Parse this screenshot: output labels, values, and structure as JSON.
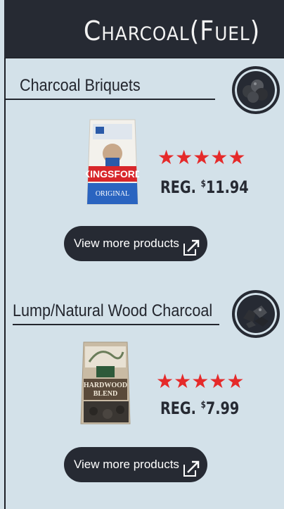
{
  "header": {
    "title": "Charcoal(Fuel)"
  },
  "sections": [
    {
      "title": "Charcoal Briquets",
      "icon": "charcoal-briquets-icon",
      "product_image": "kingsford-original-bag",
      "rating": "★★★★★",
      "price_prefix": "REG. ",
      "price_currency": "$",
      "price_value": "11.94",
      "button_label": "View more products"
    },
    {
      "title": "Lump/Natural Wood Charcoal",
      "icon": "lump-charcoal-icon",
      "product_image": "hardwood-blend-bag",
      "rating": "★★★★★",
      "price_prefix": "REG. ",
      "price_currency": "$",
      "price_value": "7.99",
      "button_label": "View more products"
    }
  ],
  "colors": {
    "dark": "#262a33",
    "background": "#d3e1e9",
    "star": "#e52a2a"
  }
}
